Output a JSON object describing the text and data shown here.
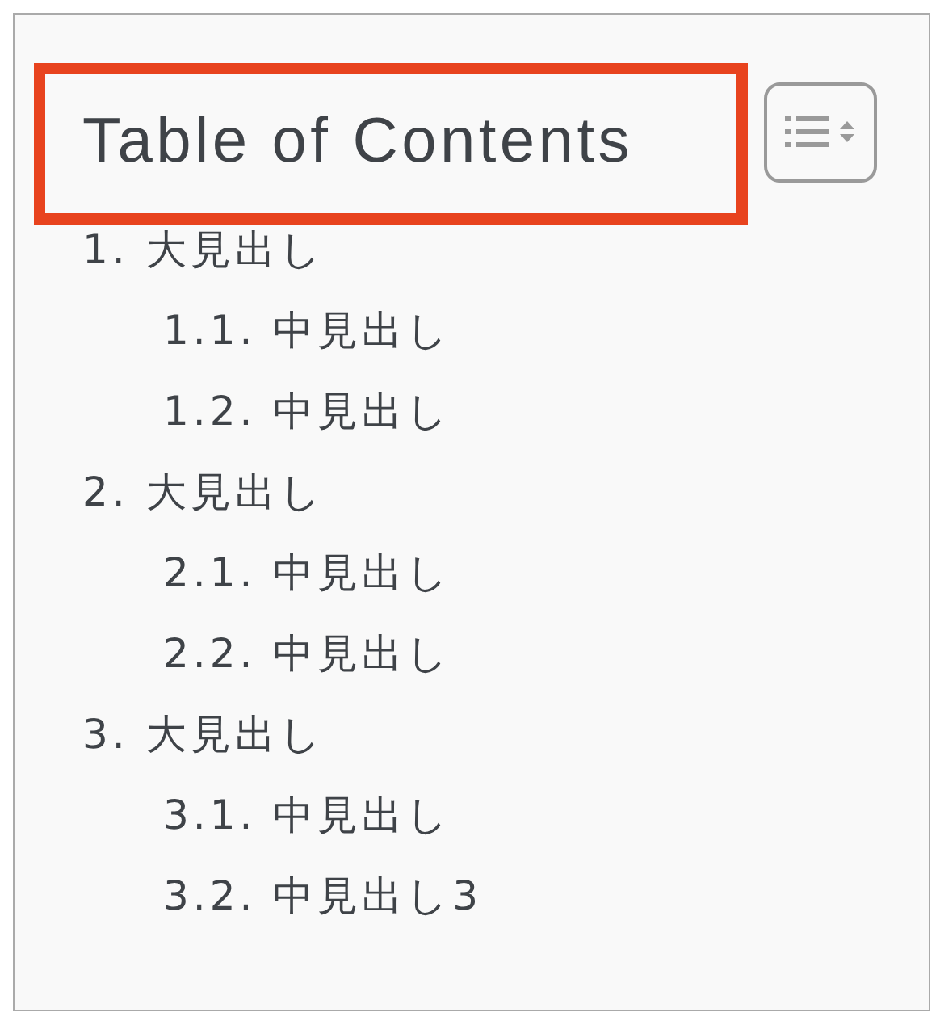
{
  "toc": {
    "title": "Table of Contents",
    "expanded": true,
    "items": [
      {
        "label": "1. 大見出し",
        "children": [
          {
            "label": "1.1. 中見出し"
          },
          {
            "label": "1.2. 中見出し"
          }
        ]
      },
      {
        "label": "2. 大見出し",
        "children": [
          {
            "label": "2.1. 中見出し"
          },
          {
            "label": "2.2. 中見出し"
          }
        ]
      },
      {
        "label": "3. 大見出し",
        "children": [
          {
            "label": "3.1. 中見出し"
          },
          {
            "label": "3.2. 中見出し3"
          }
        ]
      }
    ]
  }
}
